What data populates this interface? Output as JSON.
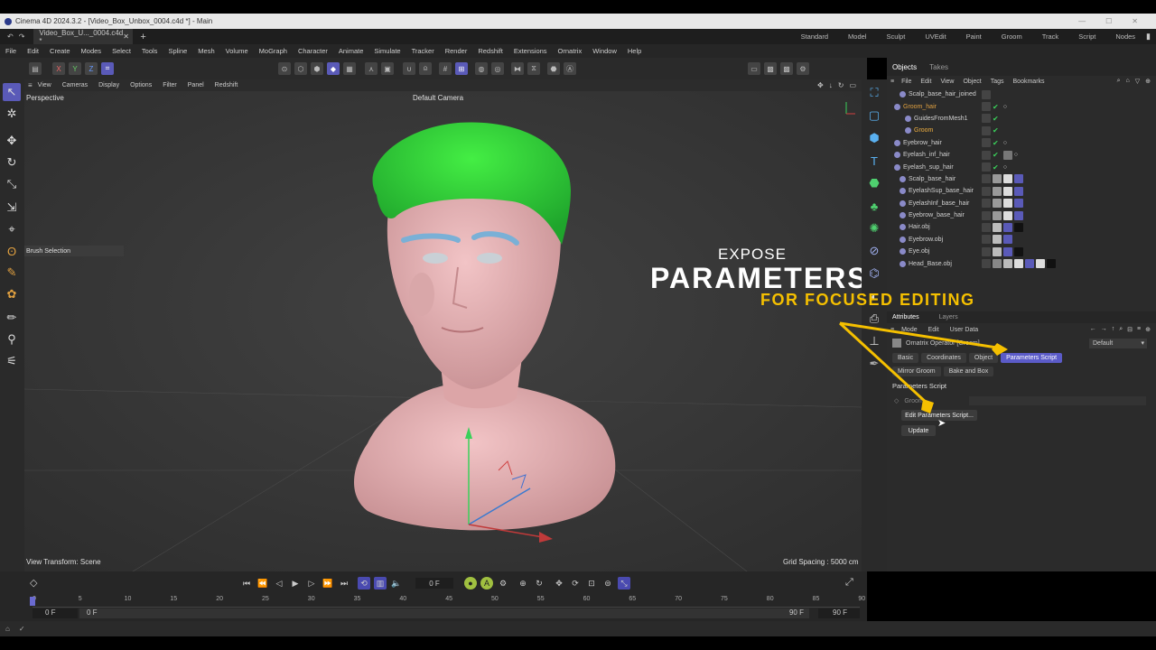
{
  "window": {
    "title": "Cinema 4D 2024.3.2 - [Video_Box_Unbox_0004.c4d *] - Main"
  },
  "tabbar": {
    "doc_tab": "Video_Box_U..._0004.c4d *",
    "layouts": [
      "Standard",
      "Model",
      "Sculpt",
      "UVEdit",
      "Paint",
      "Groom",
      "Track",
      "Script",
      "Nodes"
    ]
  },
  "menubar": [
    "File",
    "Edit",
    "Create",
    "Modes",
    "Select",
    "Tools",
    "Spline",
    "Mesh",
    "Volume",
    "MoGraph",
    "Character",
    "Animate",
    "Simulate",
    "Tracker",
    "Render",
    "Redshift",
    "Extensions",
    "Ornatrix",
    "Window",
    "Help"
  ],
  "toolbar": {
    "axis": [
      "X",
      "Y",
      "Z"
    ]
  },
  "viewport": {
    "menu": [
      "View",
      "Cameras",
      "Display",
      "Options",
      "Filter",
      "Panel",
      "Redshift"
    ],
    "label": "Perspective",
    "camera": "Default Camera",
    "brush_panel": "Brush Selection",
    "view_transform": "View Transform: Scene",
    "grid_spacing": "Grid Spacing : 5000 cm"
  },
  "overlay": {
    "line1": "EXPOSE",
    "line2": "PARAMETERS",
    "line3": "FOR FOCUSED EDITING",
    "accent": "#f5c000"
  },
  "objects_panel": {
    "tabs": [
      "Objects",
      "Takes"
    ],
    "menu": [
      "File",
      "Edit",
      "View",
      "Object",
      "Tags",
      "Bookmarks"
    ],
    "rows": [
      {
        "name": "Scalp_base_hair_joined",
        "color": "#d0d0d0"
      },
      {
        "name": "Groom_hair",
        "color": "#e0a040"
      },
      {
        "name": "GuidesFromMesh1",
        "color": "#d0d0d0"
      },
      {
        "name": "Groom",
        "color": "#f0b040"
      },
      {
        "name": "Eyebrow_hair",
        "color": "#d0d0d0"
      },
      {
        "name": "Eyelash_inf_hair",
        "color": "#d0d0d0"
      },
      {
        "name": "Eyelash_sup_hair",
        "color": "#d0d0d0"
      },
      {
        "name": "Scalp_base_hair",
        "color": "#d0d0d0"
      },
      {
        "name": "EyelashSup_base_hair",
        "color": "#d0d0d0"
      },
      {
        "name": "EyelashInf_base_hair",
        "color": "#d0d0d0"
      },
      {
        "name": "Eyebrow_base_hair",
        "color": "#d0d0d0"
      },
      {
        "name": "Hair.obj",
        "color": "#d0d0d0"
      },
      {
        "name": "Eyebrow.obj",
        "color": "#d0d0d0"
      },
      {
        "name": "Eye.obj",
        "color": "#d0d0d0"
      },
      {
        "name": "Head_Base.obj",
        "color": "#d0d0d0"
      }
    ]
  },
  "attributes_panel": {
    "tabs": [
      "Attributes",
      "Layers"
    ],
    "menu": [
      "Mode",
      "Edit",
      "User Data"
    ],
    "object_label": "Ornatrix Operator [Groom]",
    "preset": "Default",
    "subtabs": [
      "Basic",
      "Coordinates",
      "Object",
      "Parameters Script",
      "Mirror Groom",
      "Bake and Box"
    ],
    "active_subtab": "Parameters Script",
    "section_title": "Parameters Script",
    "field_label": "Groom",
    "edit_button": "Edit Parameters Script...",
    "update_button": "Update"
  },
  "timeline": {
    "current_frame": "0 F",
    "ruler": [
      "0",
      "5",
      "10",
      "15",
      "20",
      "25",
      "30",
      "35",
      "40",
      "45",
      "50",
      "55",
      "60",
      "65",
      "70",
      "75",
      "80",
      "85",
      "90"
    ],
    "start": "0 F",
    "start2": "0 F",
    "end": "90 F",
    "end2": "90 F"
  }
}
